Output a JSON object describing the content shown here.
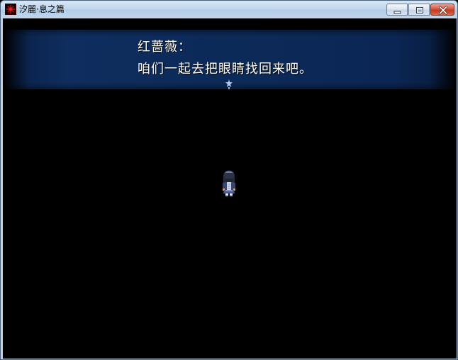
{
  "window": {
    "title": "汐麗·息之篇",
    "icon": "game-app-icon",
    "buttons": {
      "minimize": "minimize-icon",
      "maximize": "maximize-icon",
      "close": "close-icon"
    }
  },
  "dialog": {
    "speaker": "红蔷薇：",
    "text": "咱们一起去把眼睛找回来吧。",
    "continue_indicator": "pause-cursor-icon"
  },
  "scene": {
    "background": "#000000",
    "character": "player-character-sprite"
  },
  "colors": {
    "dialog_band": "#0f2d5e",
    "text": "#ffffff",
    "close_button": "#c03a21"
  }
}
